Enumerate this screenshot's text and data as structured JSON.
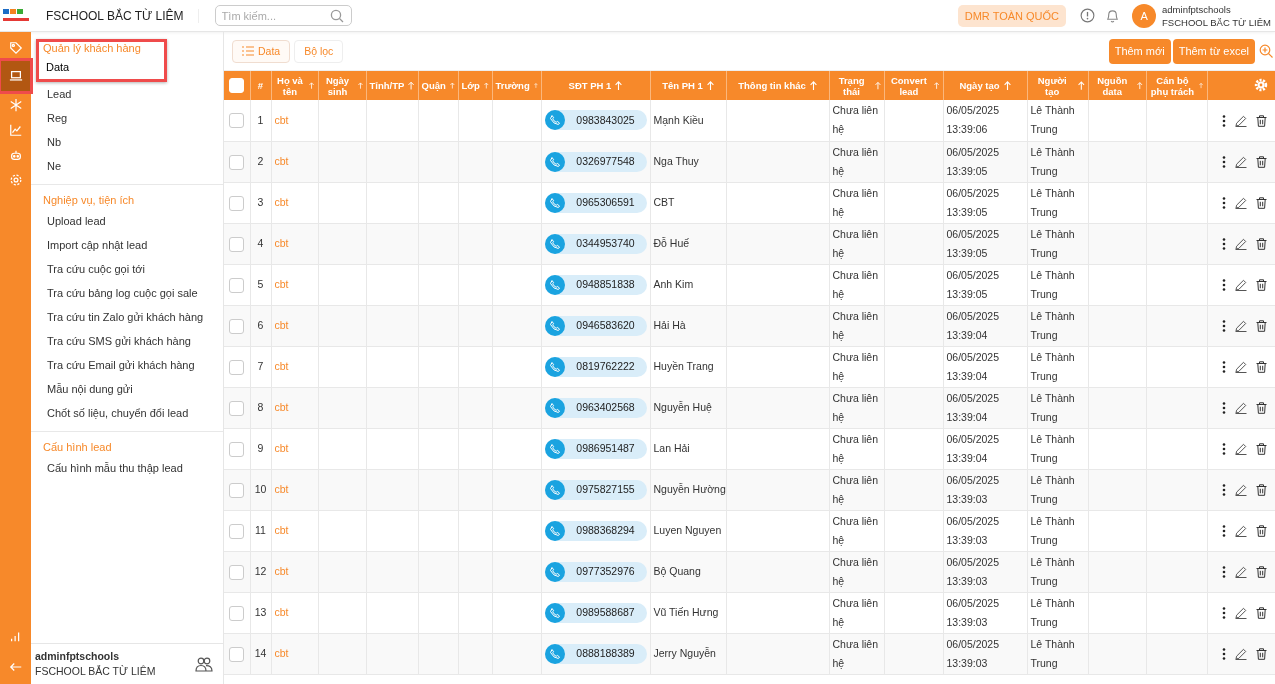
{
  "header": {
    "title": "FSCHOOL BẮC TỪ LIÊM",
    "search": {
      "placeholder": "Tìm kiếm..."
    },
    "scope_badge": "DMR TOÀN QUỐC",
    "avatar_letter": "A",
    "user_name": "adminfptschools",
    "user_org": "FSCHOOL BẮC TỪ LIÊM"
  },
  "rail": {
    "top": [
      {
        "kind": "tag",
        "selected": false,
        "highlighted": false
      },
      {
        "kind": "laptop",
        "selected": true,
        "highlighted": true
      },
      {
        "kind": "asterisk",
        "selected": false,
        "highlighted": false
      },
      {
        "kind": "chart",
        "selected": false,
        "highlighted": false
      },
      {
        "kind": "robot",
        "selected": false,
        "highlighted": false
      },
      {
        "kind": "gear",
        "selected": false,
        "highlighted": false
      }
    ],
    "bottom": [
      {
        "kind": "bars",
        "selected": false,
        "highlighted": false
      },
      {
        "kind": "back",
        "selected": false,
        "highlighted": false
      }
    ]
  },
  "sidebar": {
    "sections": [
      {
        "title": "Quản lý khách hàng",
        "highlighted": true,
        "items": [
          {
            "label": "Data",
            "selected": true
          },
          {
            "label": "Lead",
            "selected": false
          },
          {
            "label": "Reg",
            "selected": false
          },
          {
            "label": "Nb",
            "selected": false
          },
          {
            "label": "Ne",
            "selected": false
          }
        ]
      },
      {
        "title": "Nghiệp vụ, tiện ích",
        "highlighted": false,
        "items": [
          {
            "label": "Upload lead",
            "selected": false
          },
          {
            "label": "Import cập nhật lead",
            "selected": false
          },
          {
            "label": "Tra cứu cuộc gọi tới",
            "selected": false
          },
          {
            "label": "Tra cứu bảng log cuộc gọi sale",
            "selected": false
          },
          {
            "label": "Tra cứu tin Zalo gửi khách hàng",
            "selected": false
          },
          {
            "label": "Tra cứu SMS gửi khách hàng",
            "selected": false
          },
          {
            "label": "Tra cứu Email gửi khách hàng",
            "selected": false
          },
          {
            "label": "Mẫu nội dung gửi",
            "selected": false
          },
          {
            "label": "Chốt số liệu, chuyển đổi lead",
            "selected": false
          }
        ]
      },
      {
        "title": "Cấu hình lead",
        "highlighted": false,
        "items": [
          {
            "label": "Cấu hình mẫu thu thập lead",
            "selected": false
          }
        ]
      }
    ],
    "footer": {
      "name": "adminfptschools",
      "org": "FSCHOOL BẮC TỪ LIÊM"
    }
  },
  "toolbar": {
    "tabs": [
      {
        "label": "Data",
        "selected": true
      },
      {
        "label": "Bộ lọc",
        "selected": false
      }
    ],
    "actions": [
      "Thêm mới",
      "Thêm từ excel"
    ]
  },
  "table": {
    "all_checked": false,
    "columns": [
      {
        "label": "#",
        "sortable": false
      },
      {
        "label": "Họ và tên",
        "sortable": true
      },
      {
        "label": "Ngày sinh",
        "sortable": true
      },
      {
        "label": "Tỉnh/TP",
        "sortable": true
      },
      {
        "label": "Quận",
        "sortable": true
      },
      {
        "label": "Lớp",
        "sortable": true
      },
      {
        "label": "Trường",
        "sortable": true
      },
      {
        "label": "SĐT PH 1",
        "sortable": true
      },
      {
        "label": "Tên PH 1",
        "sortable": true
      },
      {
        "label": "Thông tin khác",
        "sortable": true
      },
      {
        "label": "Trạng thái",
        "sortable": true
      },
      {
        "label": "Convert lead",
        "sortable": true
      },
      {
        "label": "Ngày tạo",
        "sortable": true
      },
      {
        "label": "Người tạo",
        "sortable": true
      },
      {
        "label": "Nguồn data",
        "sortable": true
      },
      {
        "label": "Cán bộ phụ trách",
        "sortable": true
      }
    ],
    "rows": [
      {
        "checked": false,
        "index": "1",
        "name": "cbt",
        "phone": "0983843025",
        "parent": "Mạnh Kiều",
        "status": "Chưa liên hệ",
        "created": "06/05/2025 13:39:06",
        "creator": "Lê Thành Trung"
      },
      {
        "checked": false,
        "index": "2",
        "name": "cbt",
        "phone": "0326977548",
        "parent": "Nga Thuy",
        "status": "Chưa liên hệ",
        "created": "06/05/2025 13:39:05",
        "creator": "Lê Thành Trung"
      },
      {
        "checked": false,
        "index": "3",
        "name": "cbt",
        "phone": "0965306591",
        "parent": "CBT",
        "status": "Chưa liên hệ",
        "created": "06/05/2025 13:39:05",
        "creator": "Lê Thành Trung"
      },
      {
        "checked": false,
        "index": "4",
        "name": "cbt",
        "phone": "0344953740",
        "parent": "Đỗ Huế",
        "status": "Chưa liên hệ",
        "created": "06/05/2025 13:39:05",
        "creator": "Lê Thành Trung"
      },
      {
        "checked": false,
        "index": "5",
        "name": "cbt",
        "phone": "0948851838",
        "parent": "Anh Kim",
        "status": "Chưa liên hệ",
        "created": "06/05/2025 13:39:05",
        "creator": "Lê Thành Trung"
      },
      {
        "checked": false,
        "index": "6",
        "name": "cbt",
        "phone": "0946583620",
        "parent": "Hải Hà",
        "status": "Chưa liên hệ",
        "created": "06/05/2025 13:39:04",
        "creator": "Lê Thành Trung"
      },
      {
        "checked": false,
        "index": "7",
        "name": "cbt",
        "phone": "0819762222",
        "parent": "Huyền Trang",
        "status": "Chưa liên hệ",
        "created": "06/05/2025 13:39:04",
        "creator": "Lê Thành Trung"
      },
      {
        "checked": false,
        "index": "8",
        "name": "cbt",
        "phone": "0963402568",
        "parent": "Nguyễn Huệ",
        "status": "Chưa liên hệ",
        "created": "06/05/2025 13:39:04",
        "creator": "Lê Thành Trung"
      },
      {
        "checked": false,
        "index": "9",
        "name": "cbt",
        "phone": "0986951487",
        "parent": "Lan Hải",
        "status": "Chưa liên hệ",
        "created": "06/05/2025 13:39:04",
        "creator": "Lê Thành Trung"
      },
      {
        "checked": false,
        "index": "10",
        "name": "cbt",
        "phone": "0975827155",
        "parent": "Nguyễn Hường",
        "status": "Chưa liên hệ",
        "created": "06/05/2025 13:39:03",
        "creator": "Lê Thành Trung"
      },
      {
        "checked": false,
        "index": "11",
        "name": "cbt",
        "phone": "0988368294",
        "parent": "Luyen Nguyen",
        "status": "Chưa liên hệ",
        "created": "06/05/2025 13:39:03",
        "creator": "Lê Thành Trung"
      },
      {
        "checked": false,
        "index": "12",
        "name": "cbt",
        "phone": "0977352976",
        "parent": "Bộ Quang",
        "status": "Chưa liên hệ",
        "created": "06/05/2025 13:39:03",
        "creator": "Lê Thành Trung"
      },
      {
        "checked": false,
        "index": "13",
        "name": "cbt",
        "phone": "0989588687",
        "parent": "Vũ Tiến Hưng",
        "status": "Chưa liên hệ",
        "created": "06/05/2025 13:39:03",
        "creator": "Lê Thành Trung"
      },
      {
        "checked": false,
        "index": "14",
        "name": "cbt",
        "phone": "0888188389",
        "parent": "Jerry Nguyễn",
        "status": "Chưa liên hệ",
        "created": "06/05/2025 13:39:03",
        "creator": "Lê Thành Trung"
      }
    ]
  }
}
